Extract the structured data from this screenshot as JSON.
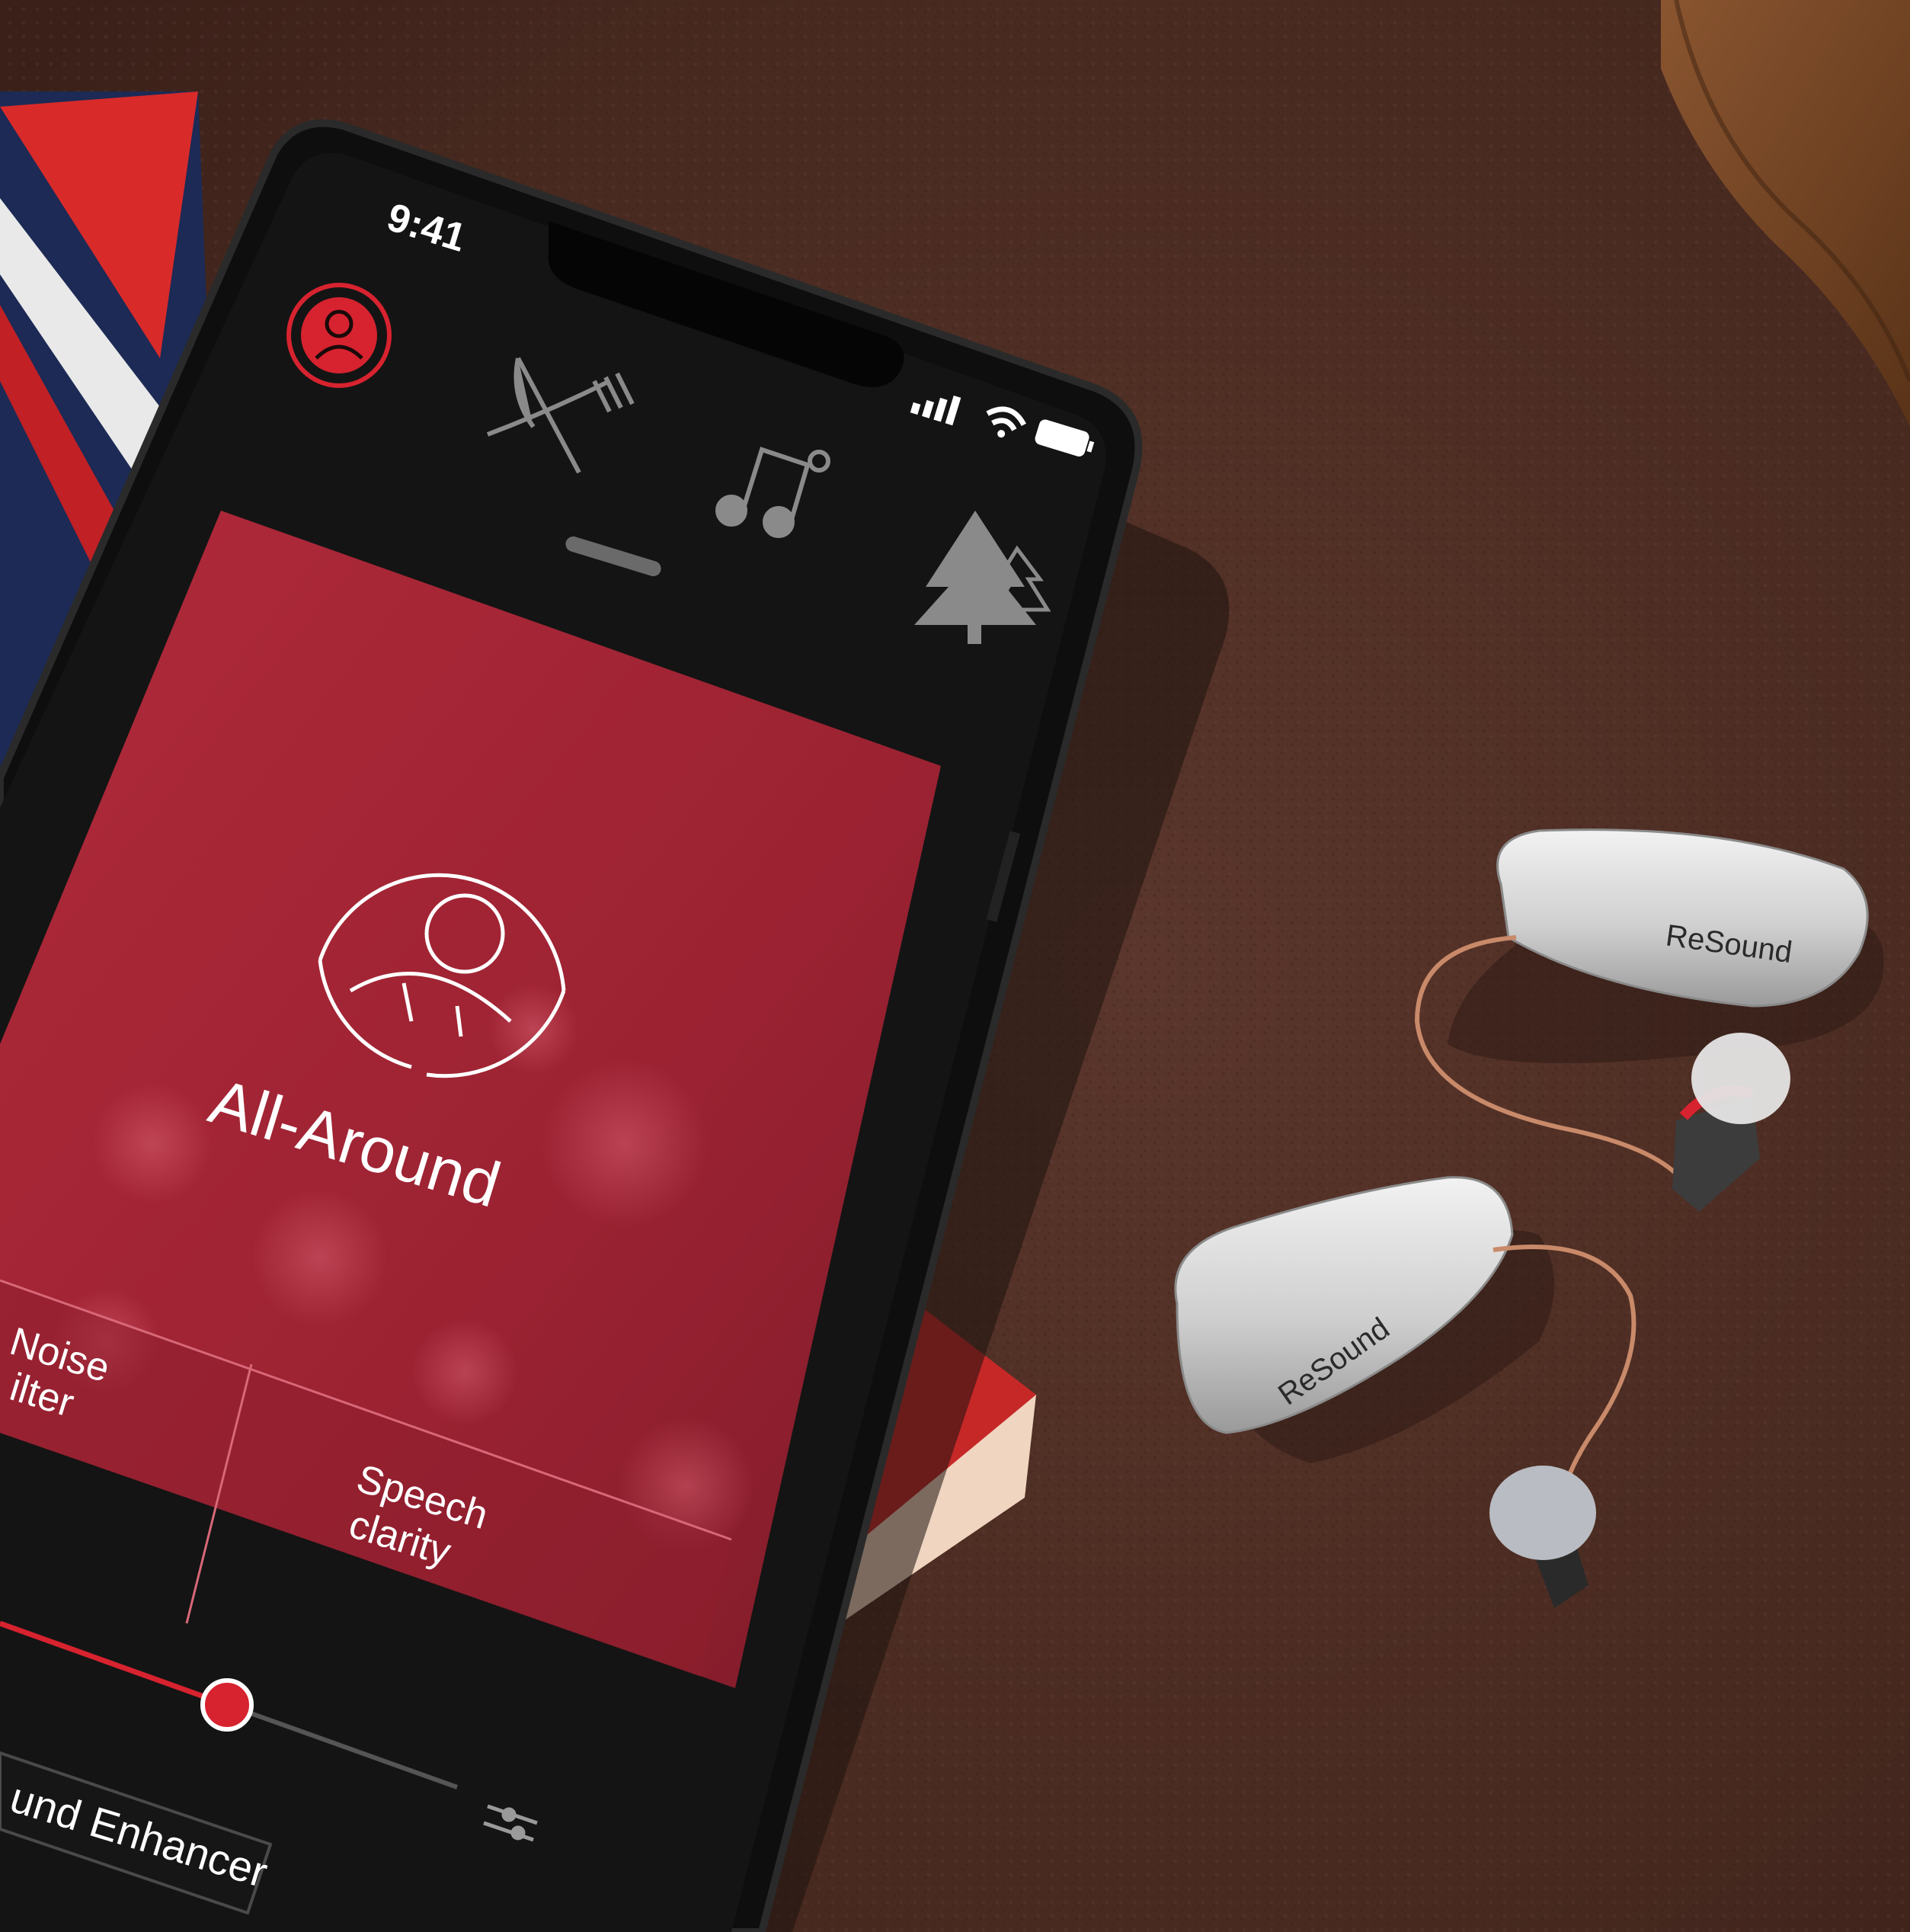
{
  "status_bar": {
    "time": "9:41"
  },
  "mode_tabs": [
    {
      "id": "all-around",
      "icon": "all-around-icon",
      "active": true
    },
    {
      "id": "restaurant",
      "icon": "fork-knife-icon",
      "active": false
    },
    {
      "id": "music",
      "icon": "music-note-icon",
      "active": false
    },
    {
      "id": "outdoor",
      "icon": "tree-icon",
      "active": false
    }
  ],
  "program_card": {
    "title": "All-Around",
    "icon": "person-cycle-icon"
  },
  "tiles": [
    {
      "label_line1": "Noise",
      "label_line2": "ilter"
    },
    {
      "label_line1": "Speech",
      "label_line2": "clarity"
    }
  ],
  "sound_enhancer": {
    "label": "und Enhancer",
    "slider_value": 0.45
  },
  "hearing_aids": [
    {
      "brand": "ReSound"
    },
    {
      "brand": "ReSound"
    }
  ],
  "colors": {
    "accent_red": "#d7232f",
    "card_red": "#a32434",
    "phone_black": "#141414",
    "leather": "#4a2c24",
    "device_silver": "#c9c9c9",
    "icon_gray": "#8a8a8a"
  }
}
